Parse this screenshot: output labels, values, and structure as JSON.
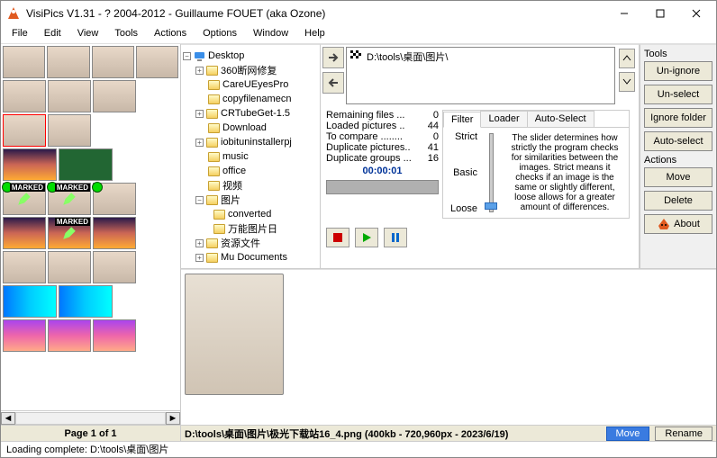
{
  "window": {
    "title": "VisiPics V1.31 - ? 2004-2012 - Guillaume FOUET (aka Ozone)"
  },
  "menu": [
    "File",
    "Edit",
    "View",
    "Tools",
    "Actions",
    "Options",
    "Window",
    "Help"
  ],
  "tree": {
    "root": "Desktop",
    "items": [
      {
        "exp": ">",
        "name": "360断网修复"
      },
      {
        "exp": "",
        "name": "CareUEyesPro"
      },
      {
        "exp": "",
        "name": "copyfilenamecn"
      },
      {
        "exp": ">",
        "name": "CRTubeGet-1.5"
      },
      {
        "exp": "",
        "name": "Download"
      },
      {
        "exp": ">",
        "name": "iobituninstallerpj"
      },
      {
        "exp": "",
        "name": "music"
      },
      {
        "exp": "",
        "name": "office"
      },
      {
        "exp": "",
        "name": "视频"
      },
      {
        "exp": "v",
        "name": "图片",
        "children": [
          {
            "name": "converted"
          },
          {
            "name": "万能图片日"
          }
        ]
      },
      {
        "exp": ">",
        "name": "资源文件"
      },
      {
        "exp": ">",
        "name": "Mu Documents"
      }
    ]
  },
  "scan": {
    "path": "D:\\tools\\桌面\\图片\\",
    "stats": {
      "remaining": {
        "label": "Remaining files ...",
        "value": "0"
      },
      "loaded": {
        "label": "Loaded pictures ..",
        "value": "44"
      },
      "compare": {
        "label": "To compare ........",
        "value": "0"
      },
      "duppics": {
        "label": "Duplicate pictures..",
        "value": "41"
      },
      "dupgrp": {
        "label": "Duplicate groups ...",
        "value": "16"
      }
    },
    "timer": "00:00:01"
  },
  "filter": {
    "tabs": [
      "Filter",
      "Loader",
      "Auto-Select"
    ],
    "levels": {
      "top": "Strict",
      "mid": "Basic",
      "bot": "Loose"
    },
    "desc": "The slider determines how strictly the program checks for similarities between the images. Strict means it checks if an image is the same or slightly different, loose allows for a greater amount of differences."
  },
  "tools": {
    "title1": "Tools",
    "btn_unignore": "Un-ignore",
    "btn_unselect": "Un-select",
    "btn_ignorefolder": "Ignore folder",
    "btn_autoselect": "Auto-select",
    "title2": "Actions",
    "btn_move": "Move",
    "btn_delete": "Delete",
    "btn_about": "About"
  },
  "thumbs": {
    "marked": "MARKED",
    "page": "Page 1 of 1"
  },
  "preview": {
    "path": "D:\\tools\\桌面\\图片\\极光下载站16_4.png  (400kb - 720,960px - 2023/6/19)",
    "btn_move": "Move",
    "btn_rename": "Rename"
  },
  "status": "Loading complete: D:\\tools\\桌面\\图片"
}
